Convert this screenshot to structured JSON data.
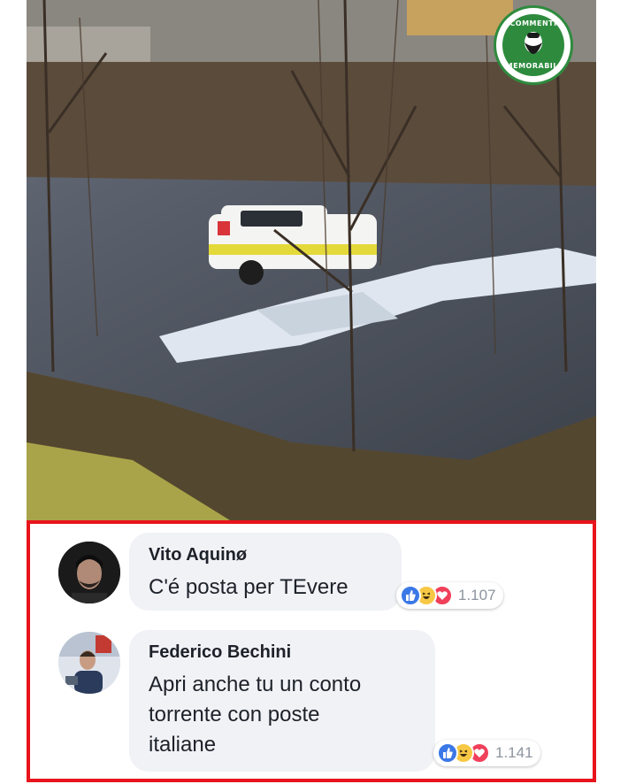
{
  "logo": {
    "top_text": "COMMENTI",
    "bottom_text": "MEMORABILI",
    "brand_color": "#2e8b3e"
  },
  "frame_color": "#e8141b",
  "comments": [
    {
      "author": "Vito Aquinø",
      "text": "C'é posta per TEvere",
      "reactions": [
        "like-icon",
        "haha-icon",
        "love-icon"
      ],
      "reaction_count": "1.107"
    },
    {
      "author": "Federico Bechini",
      "text_lines": [
        "Apri anche tu un conto",
        "torrente con poste",
        "italiane"
      ],
      "reactions": [
        "like-icon",
        "haha-icon",
        "love-icon"
      ],
      "reaction_count": "1.141"
    }
  ]
}
